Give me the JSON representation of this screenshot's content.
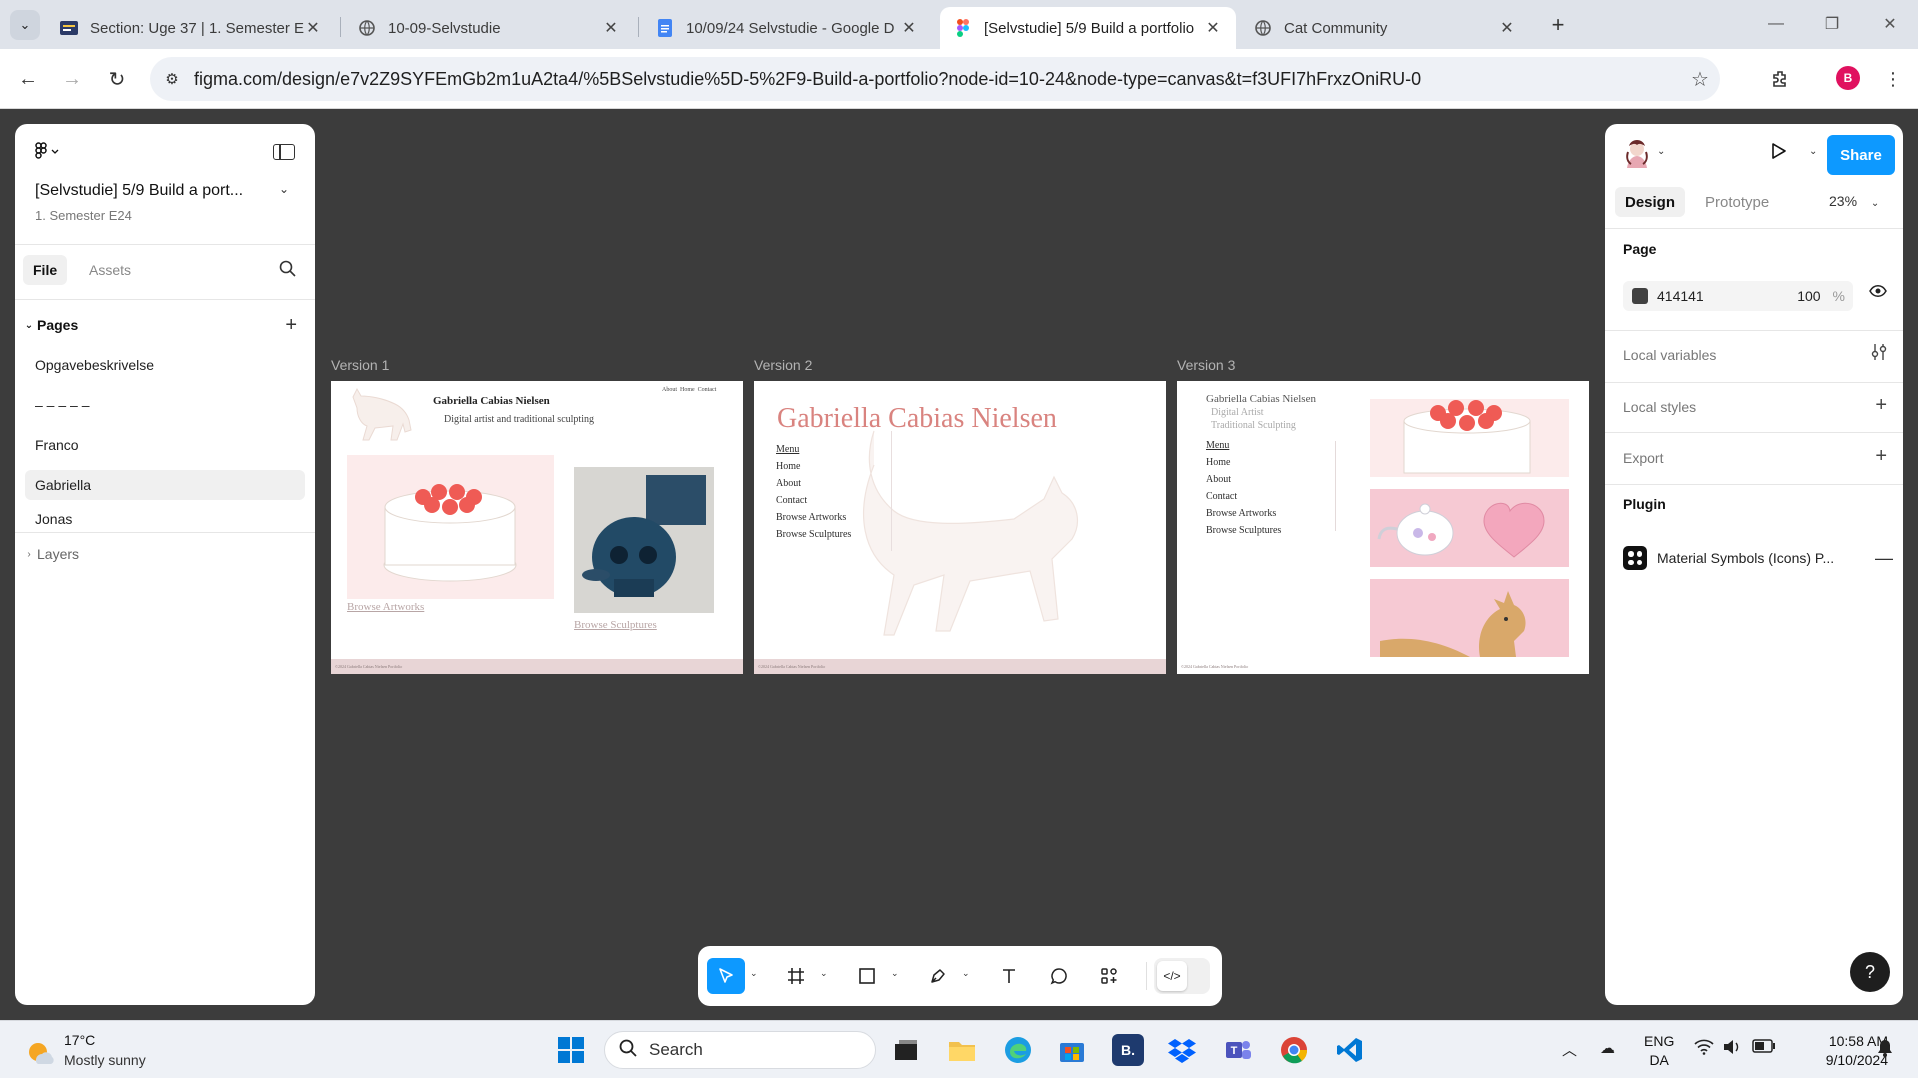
{
  "browser": {
    "tabs": [
      {
        "title": "Section: Uge 37 | 1. Semester E2",
        "active": false
      },
      {
        "title": "10-09-Selvstudie",
        "active": false
      },
      {
        "title": "10/09/24 Selvstudie - Google D",
        "active": false
      },
      {
        "title": "[Selvstudie] 5/9 Build a portfolio",
        "active": true
      },
      {
        "title": "Cat Community",
        "active": false
      }
    ],
    "url": "figma.com/design/e7v2Z9SYFEmGb2m1uA2ta4/%5BSelvstudie%5D-5%2F9-Build-a-portfolio?node-id=10-24&node-type=canvas&t=f3UFI7hFrxzOniRU-0",
    "profile_initial": "B"
  },
  "left_panel": {
    "file_title": "[Selvstudie] 5/9 Build a port...",
    "file_subtitle": "1. Semester E24",
    "tab_file": "File",
    "tab_assets": "Assets",
    "pages_heading": "Pages",
    "pages": [
      "Opgavebeskrivelse",
      "– – – – –",
      "Franco",
      "Gabriella",
      "Jonas"
    ],
    "selected_page": "Gabriella",
    "layers_heading": "Layers"
  },
  "canvas": {
    "frames": [
      {
        "label": "Version 1",
        "name": "Gabriella Cabias Nielsen",
        "tagline": "Digital artist and traditional sculpting",
        "nav": "About  Home  Contact",
        "link1": "Browse Artworks",
        "link2": "Browse Sculptures",
        "footer": "©2024 Gabriella Cabias Nielsen Portfolio"
      },
      {
        "label": "Version 2",
        "name": "Gabriella Cabias Nielsen",
        "menu": [
          "Menu",
          "Home",
          "About",
          "Contact",
          "Browse Artworks",
          "Browse Sculptures"
        ],
        "footer": "©2024 Gabriella Cabias Nielsen Portfolio"
      },
      {
        "label": "Version 3",
        "name": "Gabriella Cabias Nielsen",
        "sub1": "Digital Artist",
        "sub2": "Traditional Sculpting",
        "menu": [
          "Menu",
          "Home",
          "About",
          "Contact",
          "Browse Artworks",
          "Browse Sculptures"
        ],
        "footer": "©2024 Gabriella Cabias Nielsen Portfolio"
      }
    ]
  },
  "right_panel": {
    "share_label": "Share",
    "tab_design": "Design",
    "tab_prototype": "Prototype",
    "zoom": "23%",
    "page_heading": "Page",
    "page_color": "414141",
    "page_color_hex": "#414141",
    "page_opacity": "100",
    "opacity_unit": "%",
    "local_variables": "Local variables",
    "local_styles": "Local styles",
    "export": "Export",
    "plugin_heading": "Plugin",
    "plugin_name": "Material Symbols (Icons) P...",
    "help": "?"
  },
  "taskbar": {
    "temperature": "17°C",
    "weather": "Mostly sunny",
    "search_label": "Search",
    "lang_top": "ENG",
    "lang_bottom": "DA",
    "time": "10:58 AM",
    "date": "9/10/2024"
  },
  "colors": {
    "figma_blue": "#0d99ff",
    "canvas_bg": "#3c3c3c",
    "title_pink": "#d9837f"
  }
}
